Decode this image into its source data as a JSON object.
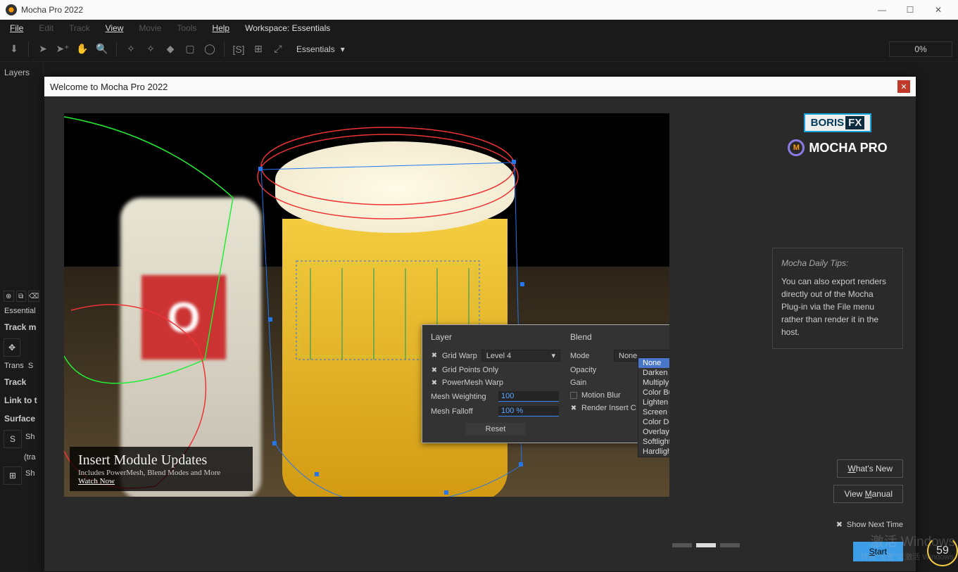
{
  "window": {
    "title": "Mocha Pro 2022"
  },
  "menu": {
    "file": "File",
    "edit": "Edit",
    "track": "Track",
    "view": "View",
    "movie": "Movie",
    "tools": "Tools",
    "help": "Help",
    "workspace_label": "Workspace: Essentials"
  },
  "toolbar": {
    "workspace": "Essentials",
    "progress": "0%"
  },
  "sidebar": {
    "layers_hdr": "Layers",
    "essentials": "Essential",
    "track_m": "Track m",
    "trans": "Trans",
    "scale_s": "S",
    "track": "Track",
    "link": "Link to t",
    "surface": "Surface",
    "sh1": "Sh",
    "tra": "(tra",
    "sh2": "Sh"
  },
  "welcome": {
    "title": "Welcome to Mocha Pro 2022",
    "brand1": "BORIS",
    "brand1fx": "FX",
    "brand2": "MOCHA PRO",
    "caption_title": "Insert Module Updates",
    "caption_sub": "Includes PowerMesh, Blend Modes and More",
    "caption_link": "Watch Now",
    "tips_title": "Mocha Daily Tips:",
    "tips_body": "You can also export renders directly out of the Mocha Plug-in via the File menu rather than render it in the host.",
    "btn_whatsnew": "What's New",
    "btn_manual": "View Manual",
    "btn_start": "Start",
    "show_next": "Show Next Time",
    "page_active": 2
  },
  "panel": {
    "layer_hdr": "Layer",
    "blend_hdr": "Blend",
    "grid_warp": "Grid Warp",
    "grid_warp_level": "Level 4",
    "grid_points": "Grid Points Only",
    "powermesh": "PowerMesh Warp",
    "mesh_weighting_lbl": "Mesh Weighting",
    "mesh_weighting": "100",
    "mesh_falloff_lbl": "Mesh Falloff",
    "mesh_falloff": "100 %",
    "reset": "Reset",
    "mode_lbl": "Mode",
    "mode_val": "None",
    "opacity_lbl": "Opacity",
    "gain_lbl": "Gain",
    "motion_blur": "Motion Blur",
    "render_insert": "Render Insert C",
    "modes": [
      "None",
      "Darken",
      "Multiply",
      "Color Burn",
      "Lighten",
      "Screen",
      "Color Dodge",
      "Overlay",
      "Softlight",
      "Hardlight"
    ]
  },
  "watermark": {
    "l1": "激活 Windows",
    "l2": "转到\"设置\"以激活 Windows",
    "badge": "59"
  }
}
